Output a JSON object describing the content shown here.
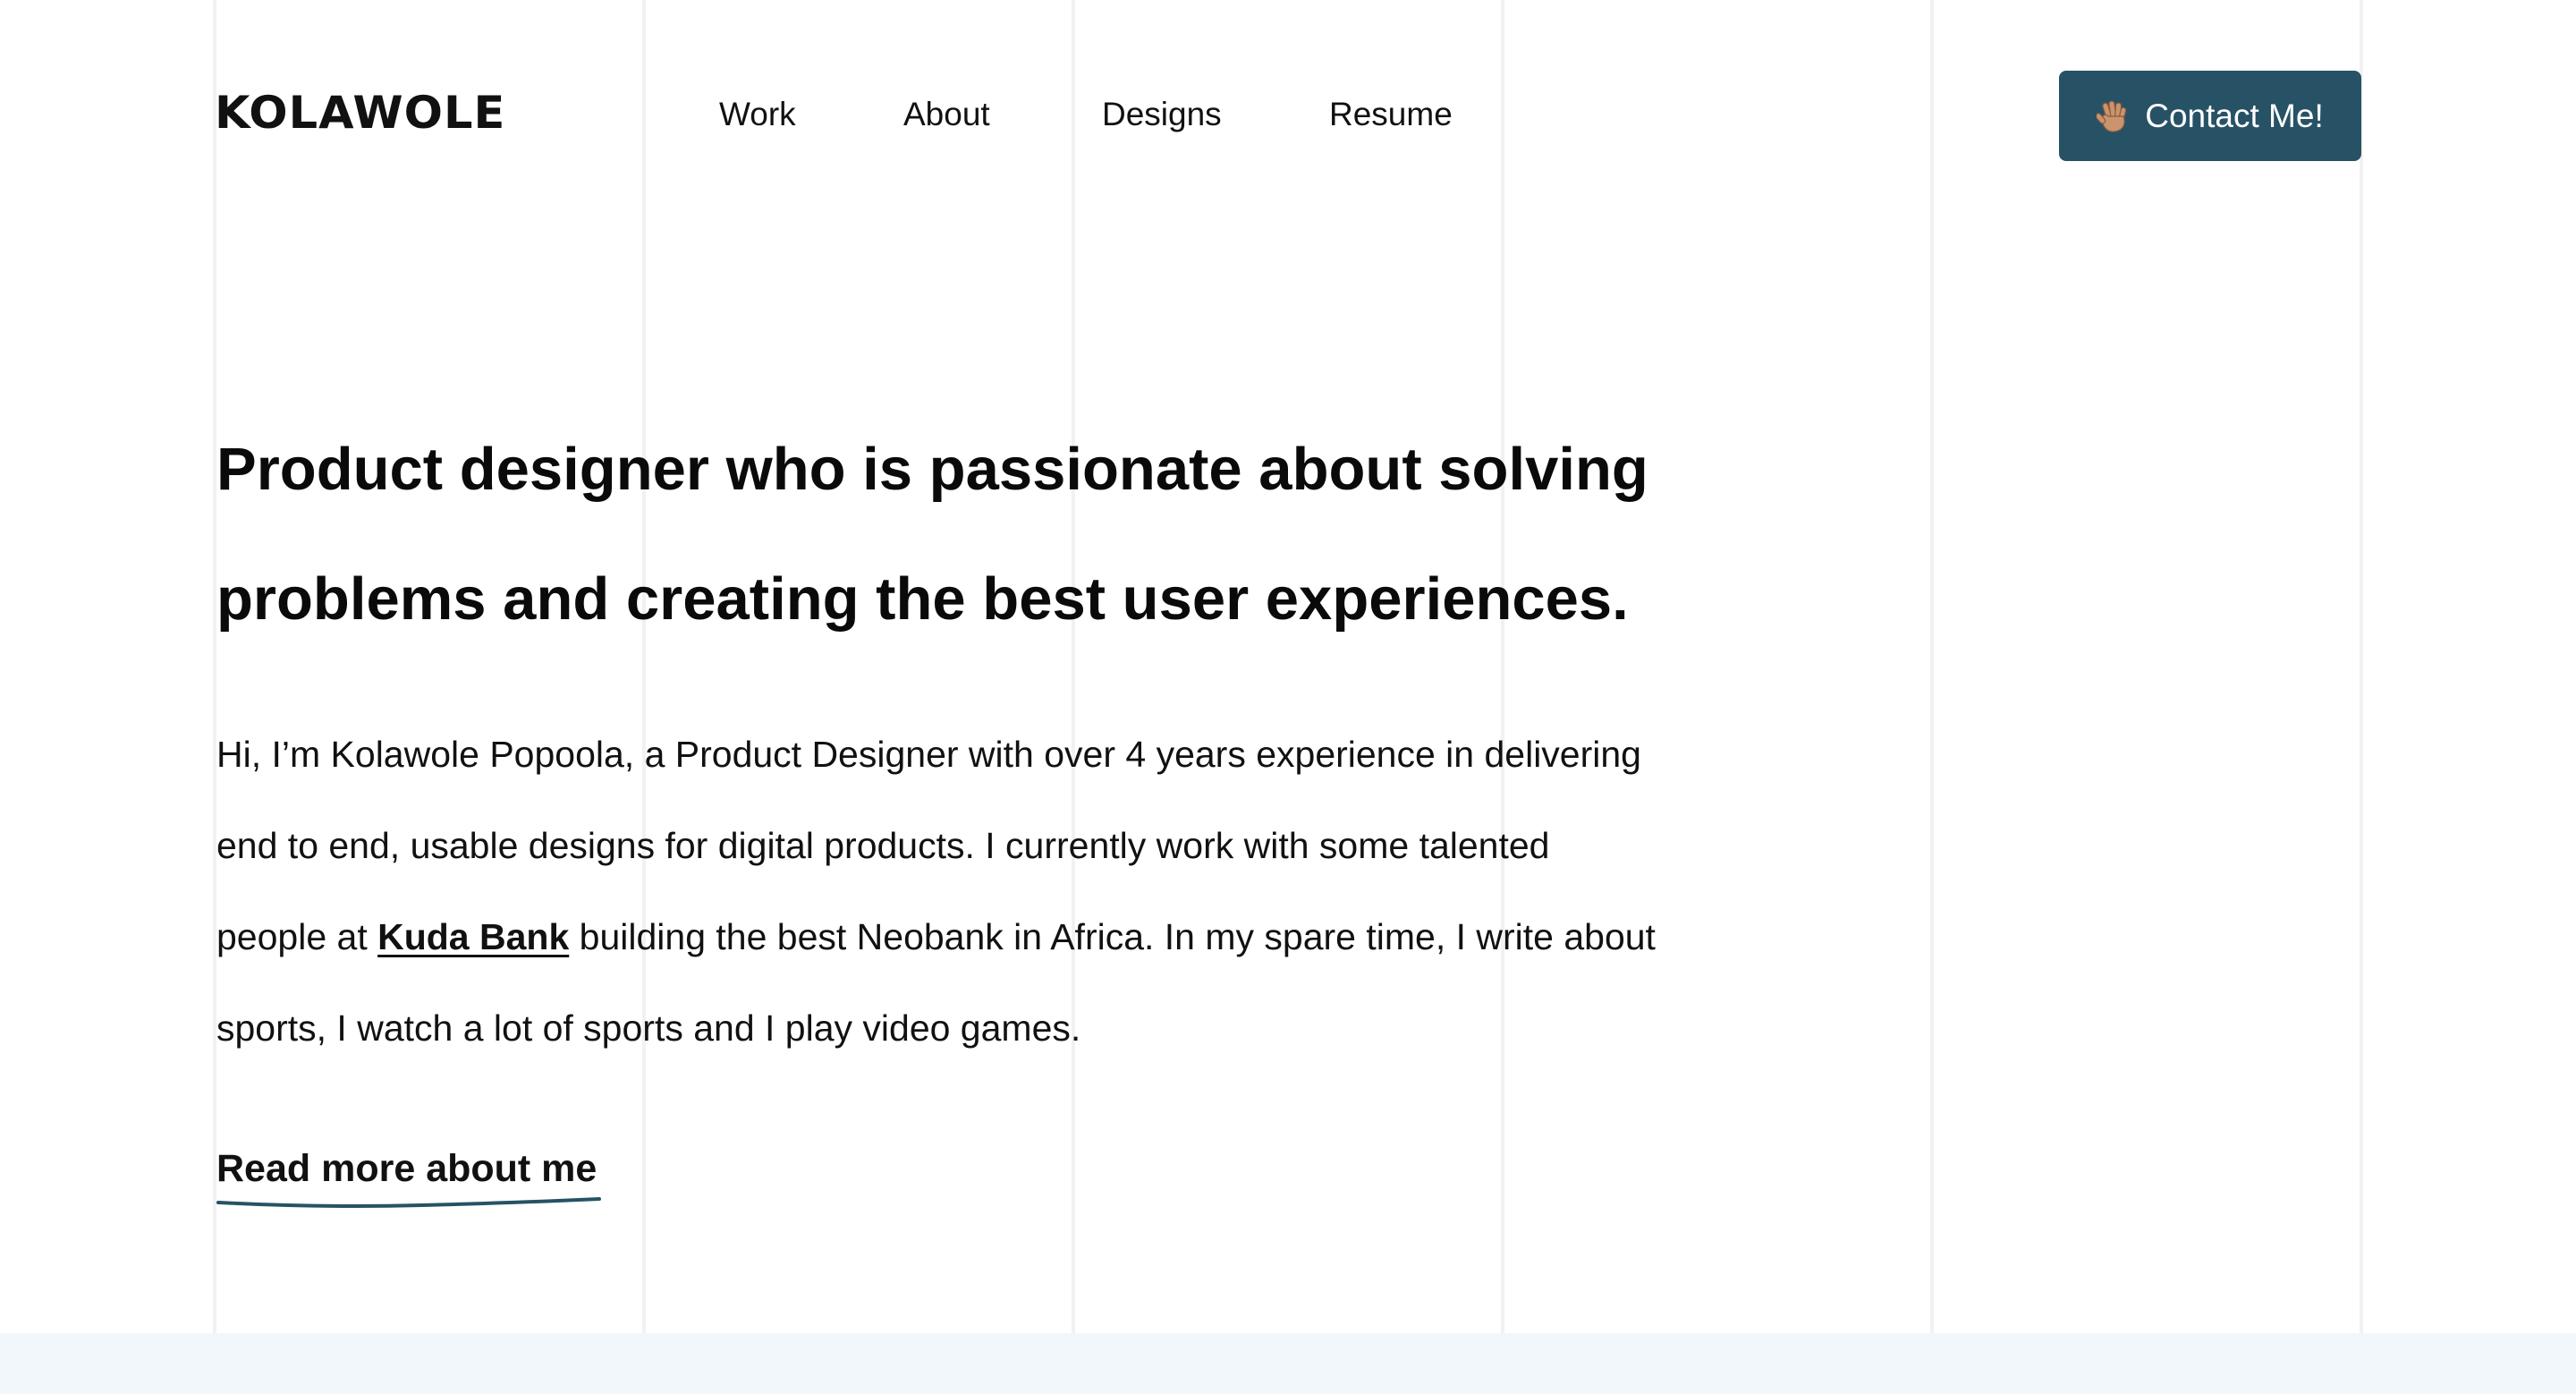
{
  "brand": {
    "logo_text": "KOLAWOLE"
  },
  "nav": {
    "items": [
      {
        "label": "Work"
      },
      {
        "label": "About"
      },
      {
        "label": "Designs"
      },
      {
        "label": "Resume"
      }
    ]
  },
  "contact_button": {
    "label": "Contact Me!",
    "icon": "waving-hand-icon"
  },
  "hero": {
    "headline_line1": "Product designer who is passionate about solving",
    "headline_line2": "problems and creating the best user experiences.",
    "intro_line1": "Hi, I’m Kolawole Popoola, a Product Designer with over 4 years experience in delivering",
    "intro_line2": "end to end, usable designs for digital products. I currently work with some talented",
    "intro_line3_before": "people at ",
    "intro_link": "Kuda Bank",
    "intro_line3_after": " building the best Neobank in Africa. In my spare time, I write about",
    "intro_line4": "sports, I watch a lot of sports and I play video games.",
    "read_more": "Read more about me"
  },
  "colors": {
    "accent": "#275266",
    "text": "#111111",
    "footer_band": "#f2f7fb",
    "grid_lines": "#f1f1f1"
  }
}
